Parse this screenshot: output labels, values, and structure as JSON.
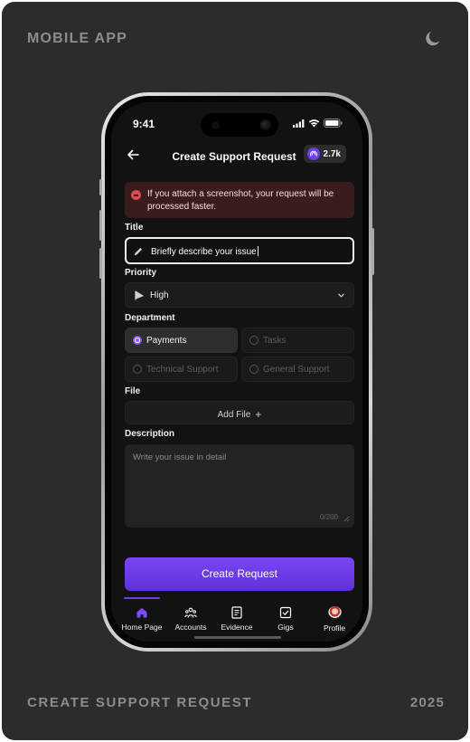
{
  "card": {
    "heading": "MOBILE APP",
    "footer_left": "CREATE SUPPORT REQUEST",
    "footer_right": "2025"
  },
  "status_bar": {
    "time": "9:41"
  },
  "header": {
    "title": "Create Support Request",
    "credits": "2.7k"
  },
  "alert": {
    "message": "If you attach a screenshot, your request will be processed faster."
  },
  "form": {
    "title_label": "Title",
    "title_value": "Briefly describe your issue",
    "priority_label": "Priority",
    "priority_value": "High",
    "department_label": "Department",
    "departments": [
      {
        "label": "Payments",
        "selected": true
      },
      {
        "label": "Tasks",
        "selected": false
      },
      {
        "label": "Technical Support",
        "selected": false
      },
      {
        "label": "General Support",
        "selected": false
      }
    ],
    "file_label": "File",
    "add_file_label": "Add File",
    "description_label": "Description",
    "description_placeholder": "Write your issue in detail",
    "char_counter": "0/200",
    "submit_label": "Create Request"
  },
  "tabbar": {
    "items": [
      {
        "label": "Home Page",
        "icon": "home-icon",
        "active": true
      },
      {
        "label": "Accounts",
        "icon": "accounts-icon",
        "active": false
      },
      {
        "label": "Evidence",
        "icon": "evidence-icon",
        "active": false
      },
      {
        "label": "Gigs",
        "icon": "gigs-icon",
        "active": false
      },
      {
        "label": "Profile",
        "icon": "avatar",
        "active": false
      }
    ]
  },
  "colors": {
    "accent": "#6d3df0",
    "alert_bg": "#3a1c1e",
    "alert_icon": "#e04a4f",
    "screen_bg": "#121212"
  }
}
